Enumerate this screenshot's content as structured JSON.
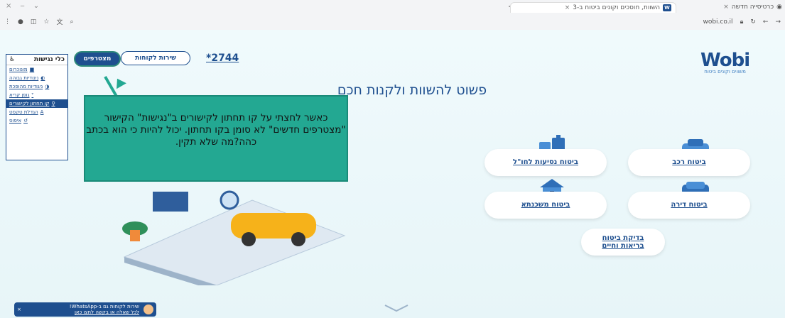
{
  "browser": {
    "active_tab_title": "השוות, חוסכים וקונים ביטוח ב-3",
    "other_tab_title": "כרטיסייה חדשה",
    "url": "wobi.co.il"
  },
  "header": {
    "logo": "Wobi",
    "logo_sub": "משווים וקונים ביטוח",
    "phone": "*2744",
    "service_button": "שירות לקוחות",
    "new_members_button": "מצטרפים",
    "headline": "פשוט להשוות ולקנות חכם"
  },
  "accessibility": {
    "title": "כלי נגישות",
    "items": [
      "מונוכרום",
      "ניגודיות גבוהה",
      "ניגודיות מהופכת",
      "גופן קריא",
      "קו תחתון לקישורים",
      "הגדלת טקסט",
      "איפוס"
    ]
  },
  "callout": {
    "text": "כאשר לחצתי על קו תחתון לקישורים ב\"נגישות\" הקישור \"מצטרפים חדשים\" לא סומן בקו תחתון. יכול להיות כי הוא בכתב כהה?מה שלא תקין."
  },
  "insurance": {
    "car": "ביטוח רכב",
    "travel": "ביטוח נסיעות לחו\"ל",
    "apartment": "ביטוח דירה",
    "mortgage": "ביטוח משכנתא",
    "health_line1": "בדיקת ביטוח",
    "health_line2": "בריאות וחיים"
  },
  "chat": {
    "line1": "שירות לקוחות גם ב-WhatsApp!",
    "line2": "לכל שאלה או בקשה לחצו כאן"
  }
}
